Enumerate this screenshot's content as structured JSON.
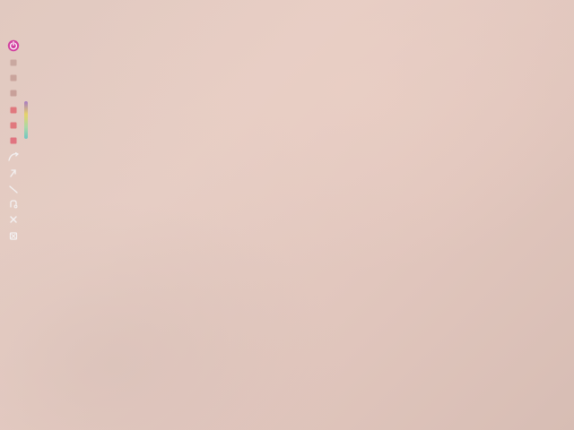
{
  "toolbar": {
    "active_tool": "pen",
    "accent_color": "#d23fa0",
    "tools": [
      {
        "id": "pen",
        "icon": "power-pen-icon",
        "color": "#d23fa0",
        "active": true
      },
      {
        "id": "shape-1",
        "icon": "square-icon",
        "color": "#c9a8a0"
      },
      {
        "id": "shape-2",
        "icon": "square-icon",
        "color": "#c9a49c"
      },
      {
        "id": "shape-3",
        "icon": "square-icon",
        "color": "#c8a099"
      },
      {
        "id": "color-red-1",
        "icon": "color-swatch-icon",
        "color": "#e0787e"
      },
      {
        "id": "color-red-2",
        "icon": "color-swatch-icon",
        "color": "#e0787e"
      },
      {
        "id": "color-red-3",
        "icon": "color-swatch-icon",
        "color": "#e07480"
      },
      {
        "id": "curve",
        "icon": "curve-icon",
        "color": "#f3f1f2"
      },
      {
        "id": "arrow",
        "icon": "arrow-icon",
        "color": "#f3f1f2"
      },
      {
        "id": "line",
        "icon": "line-icon",
        "color": "#f3f1f2"
      },
      {
        "id": "lasso",
        "icon": "lasso-icon",
        "color": "#f3f1f2"
      },
      {
        "id": "close",
        "icon": "close-icon",
        "color": "#f3f1f2"
      },
      {
        "id": "clear",
        "icon": "clear-icon",
        "color": "#f3f1f2"
      }
    ],
    "palette_colors": [
      "#a779c4",
      "#e6d36a",
      "#a8d8a8",
      "#6fc6c3"
    ]
  }
}
